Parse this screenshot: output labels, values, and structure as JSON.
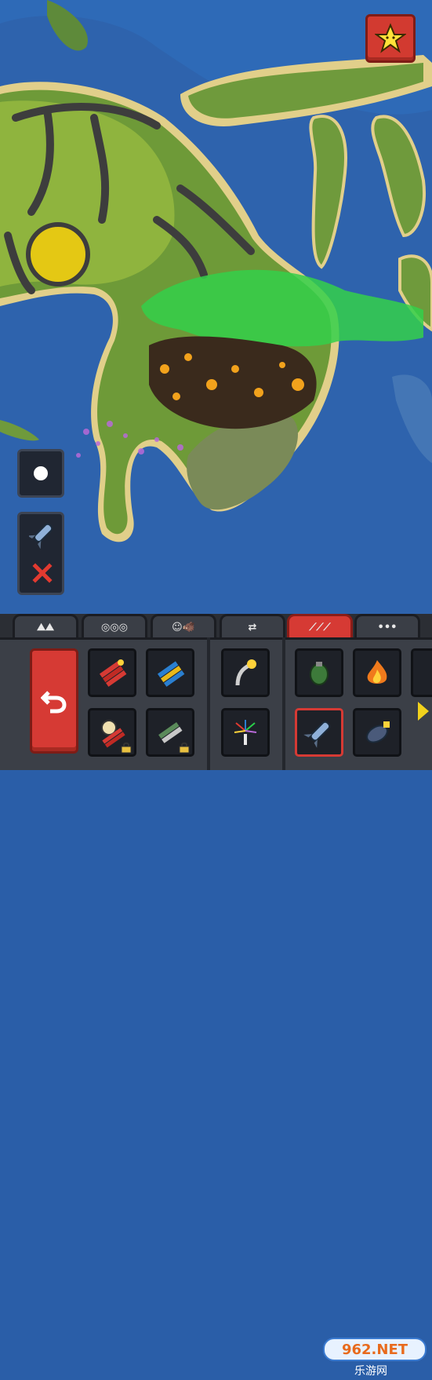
{
  "hud": {
    "favorites_icon": "star-icon",
    "brush_icon": "brush-size-dot-icon",
    "selected_power_icon": "missile-icon",
    "clear_power_icon": "x-mark-icon"
  },
  "tabs": [
    {
      "icon": "terrain-icon",
      "glyph": "⛰⛰"
    },
    {
      "icon": "bombs-icon",
      "glyph": "◎◎◎"
    },
    {
      "icon": "creatures-icon",
      "glyph": "☺🐗"
    },
    {
      "icon": "links-icon",
      "glyph": "⇄"
    },
    {
      "icon": "destruction-icon",
      "glyph": "⟋⟋⟋"
    },
    {
      "icon": "more-icon",
      "glyph": "•••"
    }
  ],
  "active_tab": 4,
  "powers": {
    "undo_icon": "undo-arrow-icon",
    "slots": [
      {
        "icon": "dynamite-icon",
        "locked": false
      },
      {
        "icon": "bomb-cluster-icon",
        "locked": false
      },
      {
        "icon": "lightning-icon",
        "locked": false
      },
      {
        "icon": "grenade-icon",
        "locked": false
      },
      {
        "icon": "fire-icon",
        "locked": false
      },
      {
        "icon": "timebomb-icon",
        "locked": true
      },
      {
        "icon": "napalm-icon",
        "locked": true
      },
      {
        "icon": "fireworks-icon",
        "locked": false
      },
      {
        "icon": "missile-icon",
        "locked": false
      },
      {
        "icon": "atomic-bomb-icon",
        "locked": false
      }
    ]
  },
  "watermark": {
    "brand": "962.NET",
    "subtitle": "乐游网"
  },
  "colors": {
    "accent_red": "#d63a34",
    "panel_dark": "#202632",
    "arrow_yellow": "#f2d21c"
  }
}
